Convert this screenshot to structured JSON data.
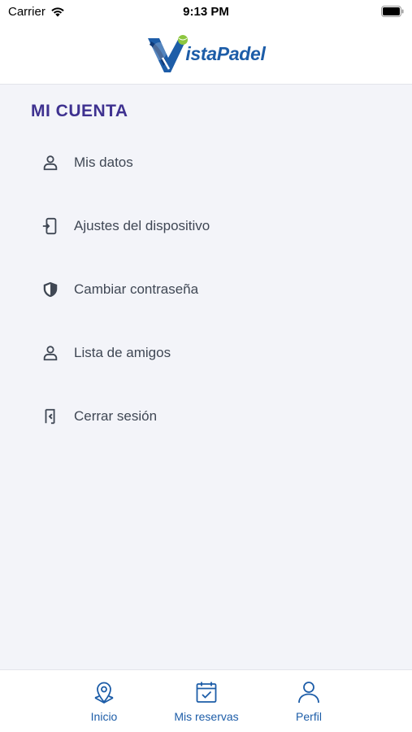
{
  "status_bar": {
    "carrier": "Carrier",
    "time": "9:13 PM"
  },
  "header": {
    "logo_text": "istaPadel"
  },
  "main": {
    "section_title": "MI CUENTA",
    "menu": [
      {
        "label": "Mis datos",
        "icon": "person-icon"
      },
      {
        "label": "Ajustes del dispositivo",
        "icon": "device-settings-icon"
      },
      {
        "label": "Cambiar contraseña",
        "icon": "shield-icon"
      },
      {
        "label": "Lista de amigos",
        "icon": "friends-icon"
      },
      {
        "label": "Cerrar sesión",
        "icon": "logout-icon"
      }
    ]
  },
  "tab_bar": {
    "tabs": [
      {
        "label": "Inicio",
        "icon": "location-pin-icon"
      },
      {
        "label": "Mis reservas",
        "icon": "calendar-check-icon"
      },
      {
        "label": "Perfil",
        "icon": "profile-icon"
      }
    ]
  },
  "colors": {
    "accent": "#1d5da8",
    "title": "#3e3190",
    "text": "#3f4754",
    "background": "#f3f4f9",
    "logo_green": "#8cc63f"
  }
}
